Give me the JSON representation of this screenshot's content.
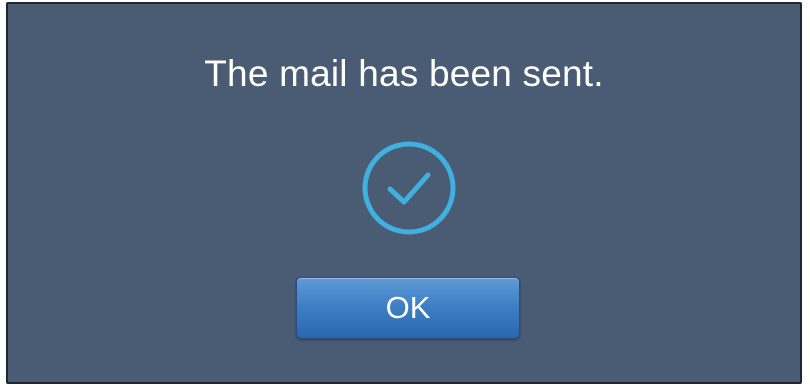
{
  "dialog": {
    "message": "The mail has been sent.",
    "icon": "check-circle-icon",
    "ok_label": "OK"
  },
  "colors": {
    "dialog_background": "#4a5b74",
    "icon_accent": "#3fb0df",
    "button": "#3f80c5",
    "text": "#ffffff"
  }
}
